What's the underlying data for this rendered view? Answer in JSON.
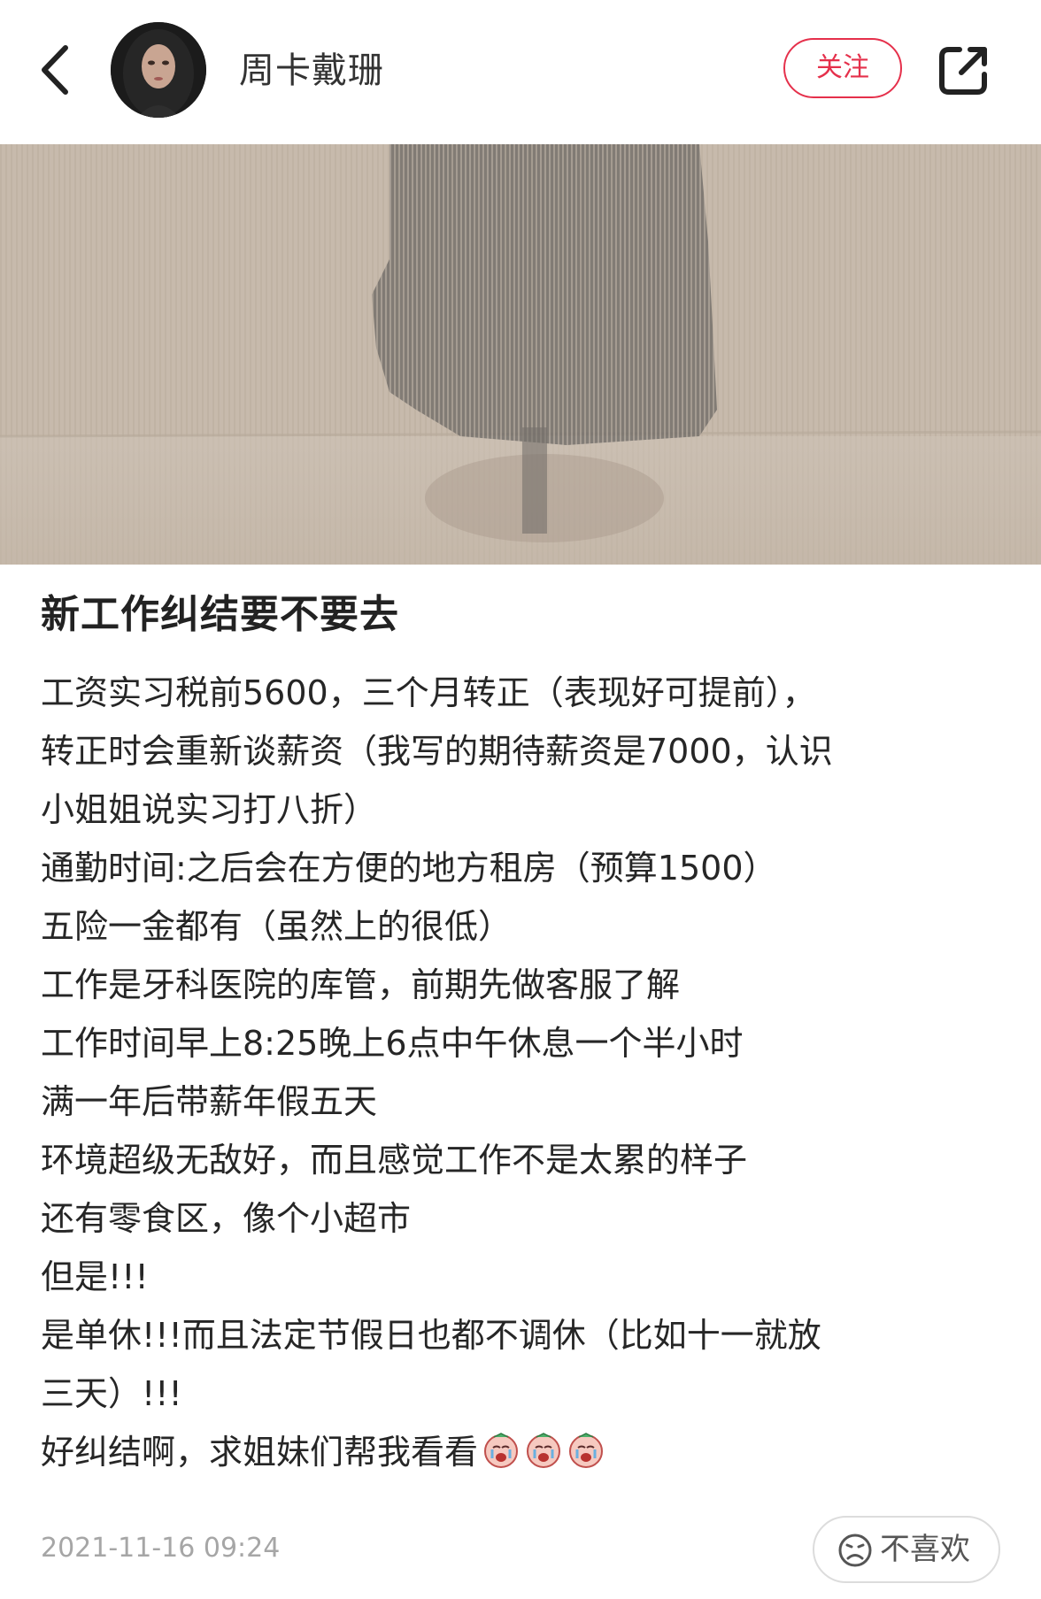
{
  "header": {
    "author_name": "周卡戴珊",
    "follow_label": "关注"
  },
  "post": {
    "title": "新工作纠结要不要去",
    "body_lines": [
      "工资实习税前5600，三个月转正（表现好可提前），",
      "转正时会重新谈薪资（我写的期待薪资是7000，认识",
      "小姐姐说实习打八折）",
      "通勤时间:之后会在方便的地方租房（预算1500）",
      "五险一金都有（虽然上的很低）",
      "工作是牙科医院的库管，前期先做客服了解",
      "工作时间早上8:25晚上6点中午休息一个半小时",
      "满一年后带薪年假五天",
      "环境超级无敌好，而且感觉工作不是太累的样子",
      "还有零食区，像个小超市",
      "但是!!!",
      "是单休!!!而且法定节假日也都不调休（比如十一就放",
      "三天）!!!",
      "好纠结啊，求姐妹们帮我看看"
    ],
    "emoji_names": [
      "crying-face-icon",
      "crying-face-icon",
      "crying-face-icon"
    ],
    "date": "2021-11-16 09:24"
  },
  "footer": {
    "dislike_label": "不喜欢"
  },
  "colors": {
    "accent": "#e5304b",
    "date_gray": "#a6a6a6",
    "cover_tone": "#cbbfb1"
  }
}
